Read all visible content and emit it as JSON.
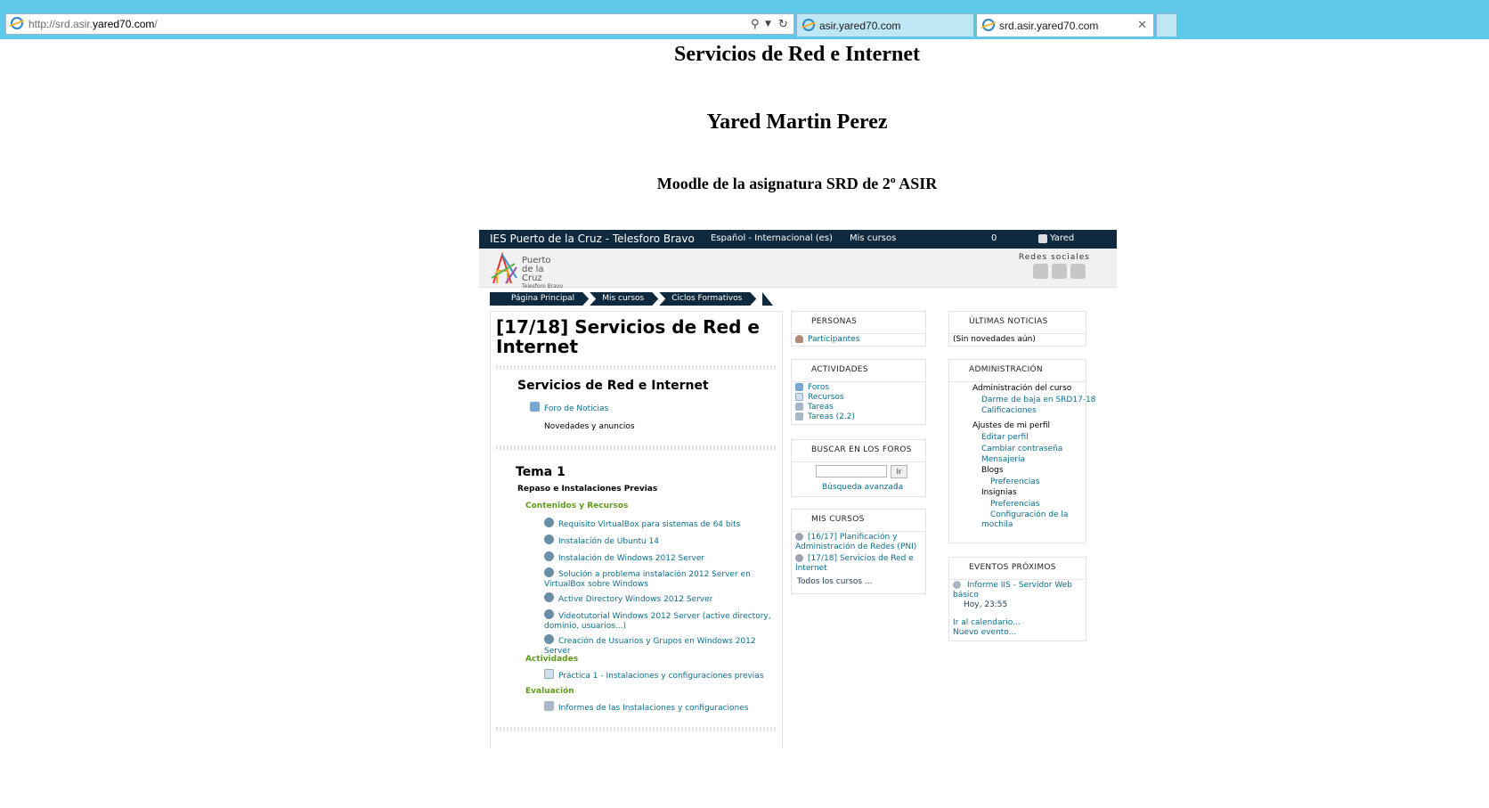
{
  "browser": {
    "url_prefix": "http://srd.asir.",
    "url_host": "yared70.com",
    "url_suffix": "/",
    "tabs": [
      {
        "label": "asir.yared70.com"
      },
      {
        "label": "srd.asir.yared70.com"
      }
    ]
  },
  "page": {
    "title": "Servicios de Red e Internet",
    "author": "Yared Martin Perez",
    "subtitle": "Moodle de la asignatura SRD de 2º ASIR"
  },
  "moodle": {
    "site_name": "IES Puerto de la Cruz - Telesforo Bravo",
    "language": "Español - Internacional (es)",
    "my_courses_menu": "Mis cursos",
    "message_count": "0",
    "user": "Yared",
    "logo_lines": [
      "Puerto",
      "de la",
      "Cruz",
      "Telesforo Bravo"
    ],
    "social_label": "Redes sociales",
    "breadcrumbs": [
      "Página Principal",
      "Mis cursos",
      "Ciclos Formativos"
    ],
    "course_title": "[17/18] Servicios de Red e Internet",
    "section0": {
      "heading": "Servicios de Red e Internet",
      "forum_link": "Foro de Noticias",
      "forum_desc": "Novedades y anuncios"
    },
    "topic1": {
      "heading": "Tema 1",
      "subheading": "Repaso e Instalaciones Previas",
      "group1": "Contenidos y Recursos",
      "resources": [
        "Requisito VirtualBox para sistemas de 64 bits",
        "Instalación de Ubuntu 14",
        "Instalación de Windows 2012 Server",
        "Solución a problema instalación 2012 Server en",
        "VirtualBox sobre Windows",
        "Active Directory Windows 2012 Server",
        "Videotutorial Windows 2012 Server (active directory,",
        "dominio, usuarios...)",
        "Creación de Usuarios y Grupos en Windows 2012",
        "Server"
      ],
      "group2": "Actividades",
      "activity": "Práctica 1 - Instalaciones y configuraciones previas",
      "group3": "Evaluación",
      "evaluation": "Informes de las Instalaciones y configuraciones"
    },
    "blocks": {
      "personas": {
        "title": "PERSONAS",
        "item": "Participantes"
      },
      "actividades": {
        "title": "ACTIVIDADES",
        "items": [
          "Foros",
          "Recursos",
          "Tareas",
          "Tareas (2.2)"
        ]
      },
      "buscar": {
        "title": "BUSCAR EN LOS FOROS",
        "button": "Ir",
        "advanced": "Búsqueda avanzada"
      },
      "mis_cursos": {
        "title": "MIS CURSOS",
        "items": [
          "[16/17] Planificación y",
          "Administración de Redes (PNI)",
          "[17/18] Servicios de Red e",
          "Internet"
        ],
        "all": "Todos los cursos ..."
      },
      "noticias": {
        "title": "ÚLTIMAS NOTICIAS",
        "text": "(Sin novedades aún)"
      },
      "admin": {
        "title": "ADMINISTRACIÓN",
        "course_admin": "Administración del curso",
        "unenrol": "Darme de baja en SRD17-18",
        "grades": "Calificaciones",
        "profile": "Ajustes de mi perfil",
        "edit_profile": "Editar perfil",
        "change_password": "Cambiar contraseña",
        "messaging": "Mensajería",
        "blogs": "Blogs",
        "blogs_prefs": "Preferencias",
        "badges": "Insignias",
        "badges_prefs": "Preferencias",
        "backpack_1": "Configuración de la",
        "backpack_2": "mochila"
      },
      "eventos": {
        "title": "EVENTOS PRÓXIMOS",
        "event_1": "Informe IIS - Servidor Web",
        "event_2": "básico",
        "when": "Hoy, 23:55",
        "calendar": "Ir al calendario...",
        "new_event": "Nuevo evento..."
      }
    }
  }
}
